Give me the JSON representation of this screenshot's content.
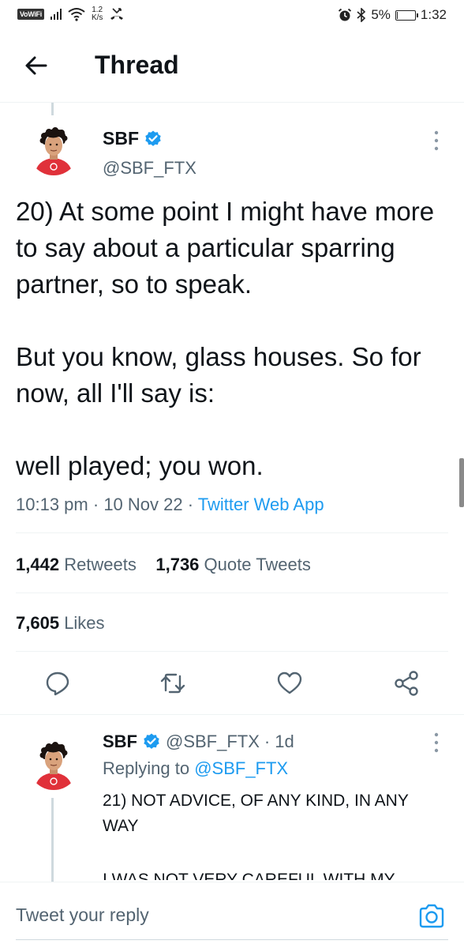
{
  "status_bar": {
    "vowifi": "VoWiFi",
    "speed_value": "1.2",
    "speed_unit": "K/s",
    "battery": "5%",
    "battery_level": 0.05,
    "time": "1:32"
  },
  "header": {
    "title": "Thread"
  },
  "tweet": {
    "name": "SBF",
    "handle": "@SBF_FTX",
    "text": "20) At some point I might have more to say about a particular sparring partner, so to speak.\n\nBut you know, glass houses.  So for now, all I'll say is:\n\nwell played; you won.",
    "time": "10:13 pm",
    "date": "10 Nov 22",
    "source": "Twitter Web App",
    "retweets_count": "1,442",
    "retweets_label": "Retweets",
    "quotes_count": "1,736",
    "quotes_label": "Quote Tweets",
    "likes_count": "7,605",
    "likes_label": "Likes"
  },
  "reply": {
    "name": "SBF",
    "handle": "@SBF_FTX",
    "age": "1d",
    "replying_prefix": "Replying to",
    "replying_to": "@SBF_FTX",
    "text": "21) NOT ADVICE, OF ANY KIND, IN ANY WAY",
    "text_cut": "I WAS NOT VERY CAREFUL WITH MY"
  },
  "reply_bar": {
    "placeholder": "Tweet your reply"
  },
  "colors": {
    "accent": "#1d9bf0",
    "text": "#0f1419",
    "secondary": "#536471"
  }
}
